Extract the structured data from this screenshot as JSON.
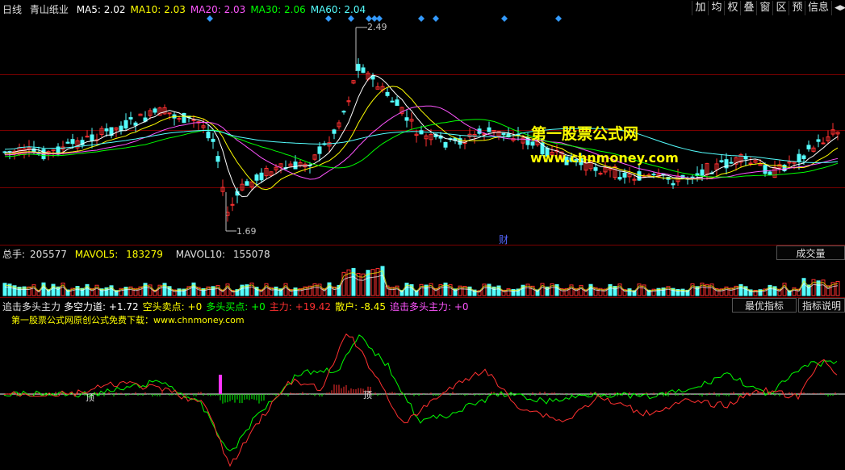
{
  "toolbar": {
    "period": "日线",
    "stock_name": "青山纸业",
    "ma": [
      {
        "label": "MA5:",
        "value": "2.02",
        "color": "#ffffff"
      },
      {
        "label": "MA10:",
        "value": "2.03",
        "color": "#ffff00"
      },
      {
        "label": "MA20:",
        "value": "2.03",
        "color": "#ff55ff"
      },
      {
        "label": "MA30:",
        "value": "2.06",
        "color": "#00ff00"
      },
      {
        "label": "MA60:",
        "value": "2.04",
        "color": "#55ffff"
      }
    ],
    "buttons": [
      "加",
      "均",
      "权",
      "叠",
      "窗",
      "区",
      "预",
      "信息"
    ]
  },
  "price_chart": {
    "high_label": "2.49",
    "low_label": "1.69",
    "event_marker": "财"
  },
  "watermark": {
    "title": "第一股票公式网",
    "url": "www.chnmoney.com"
  },
  "volume_panel": {
    "label": "总手:",
    "value": "205577",
    "mavol5_label": "MAVOL5:",
    "mavol5": "183279",
    "mavol10_label": "MAVOL10:",
    "mavol10": "155078",
    "dropdown": "成交量"
  },
  "indicator_panel": {
    "name": "追击多头主力",
    "items": [
      {
        "label": "多空力道:",
        "value": "+1.72",
        "color": "#ffffff"
      },
      {
        "label": "空头卖点:",
        "value": "+0",
        "color": "#ffff00"
      },
      {
        "label": "多头买点:",
        "value": "+0",
        "color": "#00ff00"
      },
      {
        "label": "主力:",
        "value": "+19.42",
        "color": "#ff3030"
      },
      {
        "label": "散户:",
        "value": "-8.45",
        "color": "#ffff00"
      },
      {
        "label": "追击多头主力:",
        "value": "+0",
        "color": "#ff55ff"
      }
    ],
    "best_button": "最优指标",
    "help_button": "指标说明",
    "subtitle": "第一股票公式网原创公式免费下载：www.chnmoney.com",
    "marker_a": "顶",
    "marker_b": "顶"
  }
}
